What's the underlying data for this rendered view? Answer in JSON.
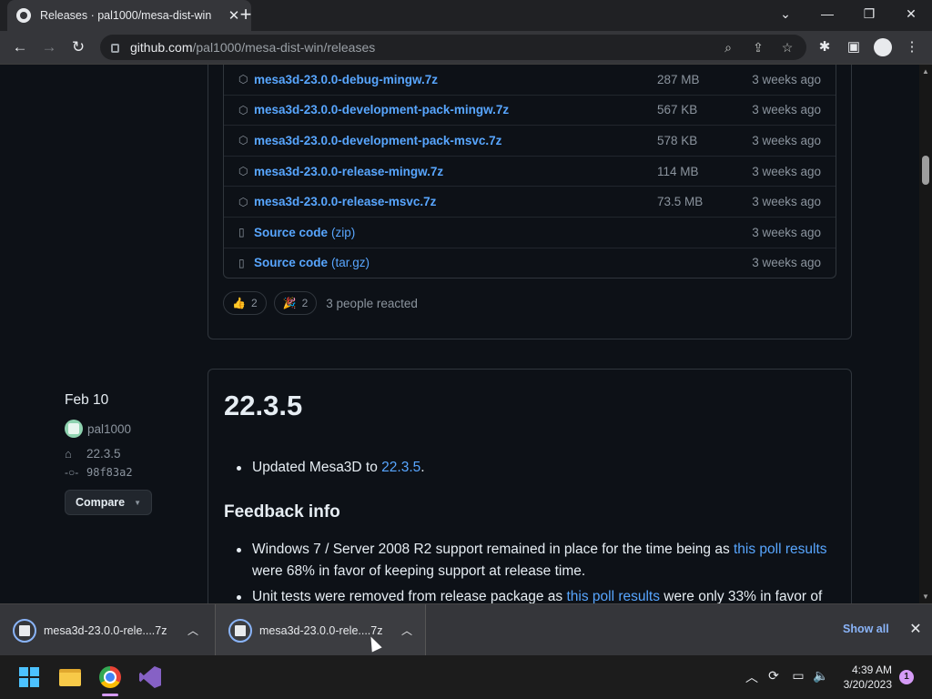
{
  "browser": {
    "tab_title": "Releases · pal1000/mesa-dist-win",
    "tab_close": "✕",
    "new_tab": "+",
    "url_host": "github.com",
    "url_path": "/pal1000/mesa-dist-win/releases",
    "icons": [
      "github-icon",
      "back-icon",
      "forward-icon",
      "reload-icon",
      "lock-icon",
      "search-icon",
      "share-icon",
      "star-icon",
      "extensions-icon",
      "sidepanel-icon",
      "profile-icon",
      "menu-icon"
    ]
  },
  "assets": [
    {
      "name": "mesa3d-23.0.0-debug-mingw.7z",
      "size": "287 MB",
      "date": "3 weeks ago"
    },
    {
      "name": "mesa3d-23.0.0-development-pack-mingw.7z",
      "size": "567 KB",
      "date": "3 weeks ago"
    },
    {
      "name": "mesa3d-23.0.0-development-pack-msvc.7z",
      "size": "578 KB",
      "date": "3 weeks ago"
    },
    {
      "name": "mesa3d-23.0.0-release-mingw.7z",
      "size": "114 MB",
      "date": "3 weeks ago"
    },
    {
      "name": "mesa3d-23.0.0-release-msvc.7z",
      "size": "73.5 MB",
      "date": "3 weeks ago"
    }
  ],
  "sources": [
    {
      "name": "Source code",
      "ext": "(zip)",
      "date": "3 weeks ago"
    },
    {
      "name": "Source code",
      "ext": "(tar.gz)",
      "date": "3 weeks ago"
    }
  ],
  "reactions": {
    "thumbs_up_count": "2",
    "tada_count": "2",
    "summary": "3 people reacted"
  },
  "release": {
    "date": "Feb 10",
    "author": "pal1000",
    "tag": "22.3.5",
    "commit": "98f83a2",
    "compare_label": "Compare",
    "title": "22.3.5",
    "bullet1_prefix": "Updated Mesa3D to ",
    "bullet1_link": "22.3.5",
    "bullet1_suffix": ".",
    "feedback_heading": "Feedback info",
    "fb1_prefix": "Windows 7 / Server 2008 R2 support remained in place for the time being as ",
    "fb1_link": "this poll results",
    "fb1_suffix": " were 68% in favor of keeping support at release time.",
    "fb2_prefix": "Unit tests were removed from release package as ",
    "fb2_link": "this poll results",
    "fb2_suffix": " were only 33% in favor of"
  },
  "downloads": {
    "item1": "mesa3d-23.0.0-rele....7z",
    "item2": "mesa3d-23.0.0-rele....7z",
    "show_all": "Show all",
    "close": "✕"
  },
  "taskbar": {
    "time": "4:39 AM",
    "date": "3/20/2023",
    "notifications": "1"
  }
}
